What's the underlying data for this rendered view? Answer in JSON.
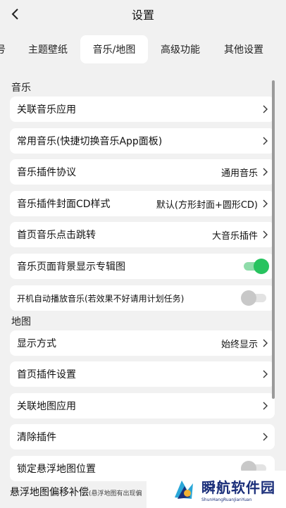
{
  "header": {
    "title": "设置",
    "back_icon": "chevron-left-icon"
  },
  "tabs": [
    {
      "label": "号",
      "active": false
    },
    {
      "label": "主题壁纸",
      "active": false
    },
    {
      "label": "音乐/地图",
      "active": true
    },
    {
      "label": "高级功能",
      "active": false
    },
    {
      "label": "其他设置",
      "active": false
    }
  ],
  "music": {
    "section_label": "音乐",
    "rows": [
      {
        "label": "关联音乐应用",
        "value": "",
        "control": "chevron"
      },
      {
        "label": "常用音乐(快捷切换音乐App面板)",
        "value": "",
        "control": "chevron"
      },
      {
        "label": "音乐插件协议",
        "value": "通用音乐",
        "control": "chevron"
      },
      {
        "label": "音乐插件封面CD样式",
        "value": "默认(方形封面+圆形CD)",
        "control": "chevron"
      },
      {
        "label": "首页音乐点击跳转",
        "value": "大音乐插件",
        "control": "chevron"
      },
      {
        "label": "音乐页面背景显示专辑图",
        "value": "",
        "control": "toggle",
        "on": true
      },
      {
        "label": "开机自动播放音乐(若效果不好请用计划任务)",
        "value": "",
        "control": "toggle",
        "on": false
      }
    ]
  },
  "map": {
    "section_label": "地图",
    "rows": [
      {
        "label": "显示方式",
        "value": "始终显示",
        "control": "chevron"
      },
      {
        "label": "首页插件设置",
        "value": "",
        "control": "chevron"
      },
      {
        "label": "关联地图应用",
        "value": "",
        "control": "chevron"
      },
      {
        "label": "清除插件",
        "value": "",
        "control": "chevron"
      },
      {
        "label": "锁定悬浮地图位置",
        "value": "",
        "control": "toggle",
        "on": false
      }
    ],
    "cutoff_label": "悬浮地图偏移补偿",
    "cutoff_note": "(悬浮地图有出现偏"
  },
  "watermark": {
    "main": "瞬航软件园",
    "sub": "ShunHangRuanJianYuan"
  },
  "colors": {
    "background": "#f1f1f1",
    "card": "#ffffff",
    "toggle_on": "#27c35f",
    "toggle_off": "#c8c8c8",
    "watermark": "#1b2f7a"
  }
}
